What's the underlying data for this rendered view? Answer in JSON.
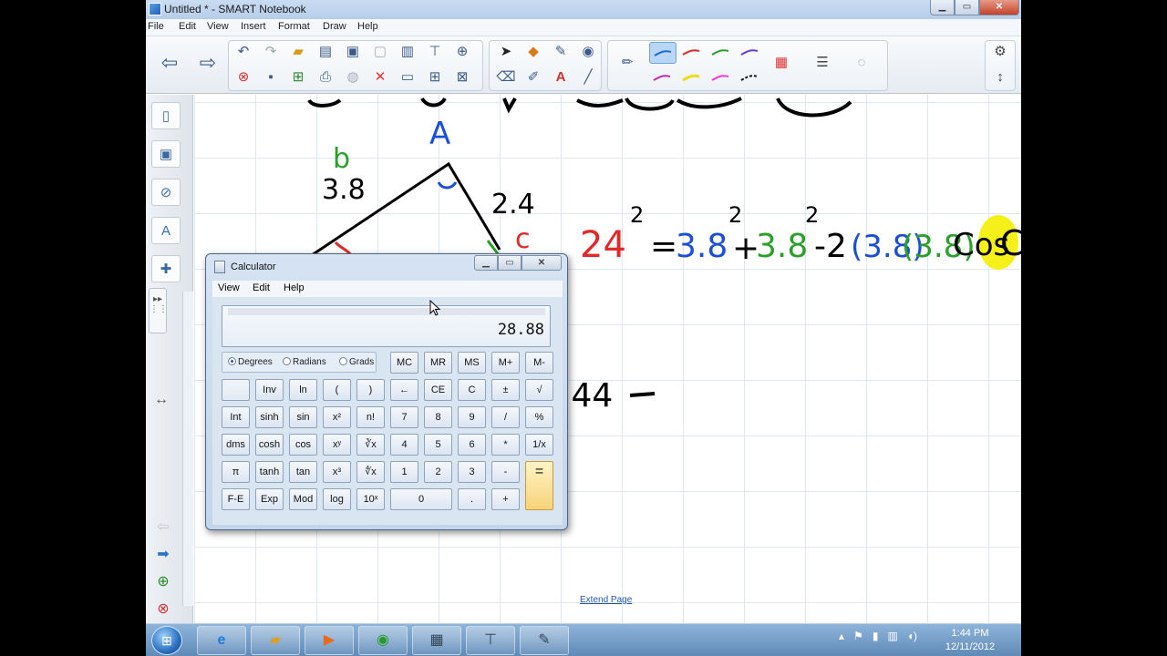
{
  "window": {
    "title": "Untitled * - SMART Notebook"
  },
  "menu": [
    "File",
    "Edit",
    "View",
    "Insert",
    "Format",
    "Draw",
    "Help"
  ],
  "canvas": {
    "extend_page": "Extend Page"
  },
  "calculator": {
    "title": "Calculator",
    "menu": [
      "View",
      "Edit",
      "Help"
    ],
    "display": "28.88",
    "angle_modes": [
      "Degrees",
      "Radians",
      "Grads"
    ],
    "selected_mode": "Degrees",
    "memory_keys": [
      "MC",
      "MR",
      "MS",
      "M+",
      "M-"
    ],
    "rows": [
      [
        "",
        "Inv",
        "ln",
        "(",
        ")",
        "←",
        "CE",
        "C",
        "±",
        "√"
      ],
      [
        "Int",
        "sinh",
        "sin",
        "x²",
        "n!",
        "7",
        "8",
        "9",
        "/",
        "%"
      ],
      [
        "dms",
        "cosh",
        "cos",
        "xʸ",
        "∛x",
        "4",
        "5",
        "6",
        "*",
        "1/x"
      ],
      [
        "π",
        "tanh",
        "tan",
        "x³",
        "∜x",
        "1",
        "2",
        "3",
        "-",
        "="
      ],
      [
        "F-E",
        "Exp",
        "Mod",
        "log",
        "10ˣ",
        "0",
        ".",
        "+"
      ]
    ]
  },
  "taskbar": {
    "time": "1:44 PM",
    "date": "12/11/2012"
  }
}
